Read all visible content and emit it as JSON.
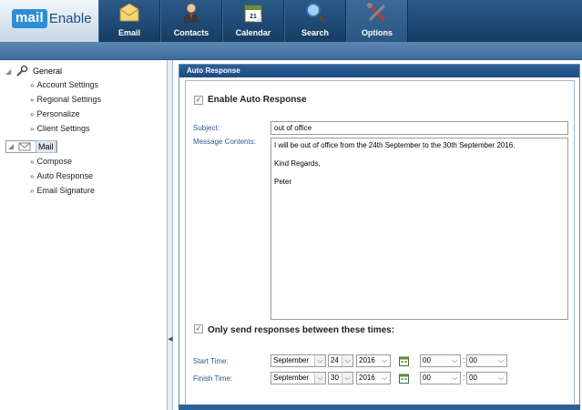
{
  "app": {
    "logo_mail": "mail",
    "logo_enable": "Enable"
  },
  "nav": [
    {
      "label": "Email",
      "icon": "envelope-icon"
    },
    {
      "label": "Contacts",
      "icon": "contacts-icon"
    },
    {
      "label": "Calendar",
      "icon": "calendar-icon"
    },
    {
      "label": "Search",
      "icon": "magnifier-icon"
    },
    {
      "label": "Options",
      "icon": "tools-icon",
      "active": true
    }
  ],
  "sidebar": {
    "general": {
      "label": "General",
      "items": [
        "Account Settings",
        "Regional Settings",
        "Personalize",
        "Client Settings"
      ]
    },
    "mail": {
      "label": "Mail",
      "items": [
        "Compose",
        "Auto Response",
        "Email Signature"
      ]
    }
  },
  "panel": {
    "title": "Auto Response",
    "enable_label": "Enable Auto Response",
    "enable_checked": true,
    "subject_label": "Subject:",
    "subject_value": "out of office",
    "message_label": "Message Contents:",
    "message_value": "I will be out of office from the 24th September to the 30th September 2016.\n\nKind Regards,\n\nPeter",
    "times_label": "Only send responses between these times:",
    "times_checked": true,
    "start": {
      "label": "Start Time:",
      "month": "September",
      "day": "24",
      "year": "2016",
      "hour": "00",
      "minute": "00"
    },
    "finish": {
      "label": "Finish Time:",
      "month": "September",
      "day": "30",
      "year": "2016",
      "hour": "00",
      "minute": "00"
    },
    "colon": ":"
  },
  "colors": {
    "accent": "#1f4a75",
    "label_blue": "#2a5a92",
    "panel_head": "#2e6199"
  }
}
